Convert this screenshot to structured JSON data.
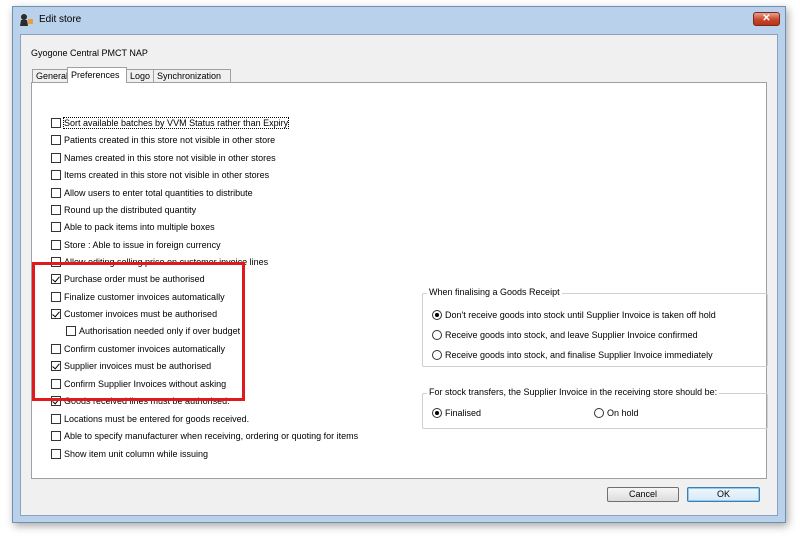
{
  "window": {
    "title": "Edit store",
    "close_label": "✕"
  },
  "store_name": "Gyogone Central PMCT NAP",
  "tabs": [
    {
      "label": "General",
      "active": false
    },
    {
      "label": "Preferences",
      "active": true
    },
    {
      "label": "Logo",
      "active": false
    },
    {
      "label": "Synchronization",
      "active": false
    }
  ],
  "preferences": [
    {
      "label": "Sort available batches by VVM Status rather than Expiry",
      "checked": false
    },
    {
      "label": "Patients created in this store not visible in other store",
      "checked": false
    },
    {
      "label": "Names created in this store not visible in other stores",
      "checked": false
    },
    {
      "label": "Items created in this store not visible in other stores",
      "checked": false
    },
    {
      "label": "Allow users to enter total quantities to distribute",
      "checked": false
    },
    {
      "label": "Round up the distributed quantity",
      "checked": false
    },
    {
      "label": "Able to pack items into multiple boxes",
      "checked": false
    },
    {
      "label": "Store : Able to issue in foreign currency",
      "checked": false
    },
    {
      "label": "Allow editing selling price on customer invoice lines",
      "checked": false
    },
    {
      "label": "Purchase order must be authorised",
      "checked": true
    },
    {
      "label": "Finalize customer invoices automatically",
      "checked": false
    },
    {
      "label": "Customer invoices must be authorised",
      "checked": true
    },
    {
      "label": "Authorisation needed only if over budget",
      "checked": false
    },
    {
      "label": "Confirm customer invoices automatically",
      "checked": false
    },
    {
      "label": "Supplier invoices must be authorised",
      "checked": true
    },
    {
      "label": "Confirm Supplier Invoices without asking",
      "checked": false
    },
    {
      "label": "Goods received lines must be authorised.",
      "checked": true
    },
    {
      "label": "Locations must be entered for goods received.",
      "checked": false
    },
    {
      "label": "Able to specify manufacturer when receiving, ordering or quoting for items",
      "checked": false
    },
    {
      "label": "Show item unit column while issuing",
      "checked": false
    }
  ],
  "goods_receipt": {
    "title": "When finalising a Goods Receipt",
    "options": [
      {
        "label": "Don't receive goods into stock until Supplier Invoice is taken off hold",
        "selected": true
      },
      {
        "label": "Receive goods into stock, and leave Supplier Invoice confirmed",
        "selected": false
      },
      {
        "label": "Receive goods into stock, and finalise Supplier Invoice immediately",
        "selected": false
      }
    ]
  },
  "stock_transfers": {
    "title": "For stock transfers, the Supplier Invoice in the receiving store should be:",
    "options": [
      {
        "label": "Finalised",
        "selected": true
      },
      {
        "label": "On hold",
        "selected": false
      }
    ]
  },
  "buttons": {
    "cancel": "Cancel",
    "ok": "OK"
  },
  "colors": {
    "highlight": "#e0191c",
    "window_frame": "#b9d1ea",
    "close_button": "#c8462c"
  }
}
